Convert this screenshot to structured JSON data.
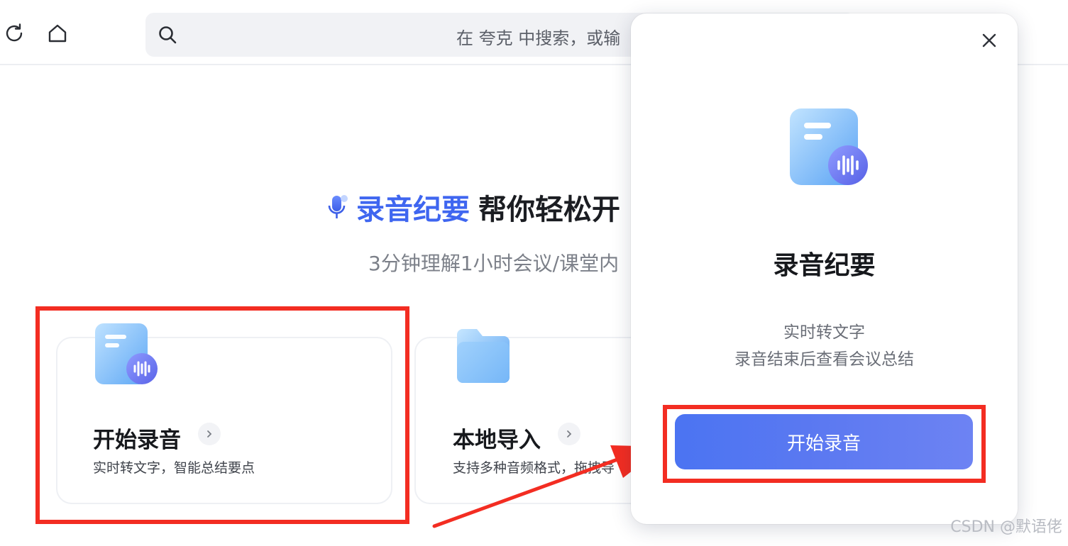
{
  "toolbar": {
    "address_placeholder": "在 夸克 中搜索，或输"
  },
  "main": {
    "headline_brand": "录音纪要",
    "headline_rest": "帮你轻松开",
    "subhead": "3分钟理解1小时会议/课堂内",
    "cards": [
      {
        "title": "开始录音",
        "desc": "实时转文字，智能总结要点"
      },
      {
        "title": "本地导入",
        "desc": "支持多种音频格式，拖拽导"
      }
    ]
  },
  "popup": {
    "title": "录音纪要",
    "line1": "实时转文字",
    "line2": "录音结束后查看会议总结",
    "start_button": "开始录音"
  },
  "watermark": "CSDN @默语佬",
  "colors": {
    "brand_blue": "#3f66f0",
    "button_blue": "#4b74f2",
    "highlight_red": "#f32d22"
  }
}
